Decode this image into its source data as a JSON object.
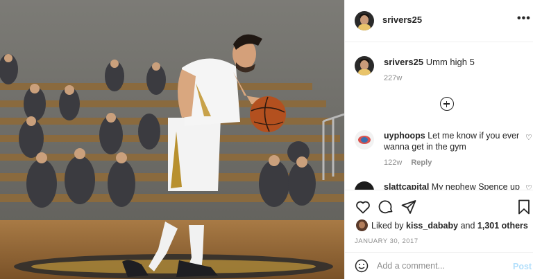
{
  "post": {
    "username": "srivers25",
    "more_icon": "more-horizontal-icon"
  },
  "caption": {
    "username": "srivers25",
    "text": "Umm high 5",
    "time": "227w"
  },
  "load_more_icon": "plus-circle-icon",
  "comments": [
    {
      "username": "uyphoops",
      "text": "Let me know if you ever wanna get in the gym",
      "time": "122w",
      "reply_label": "Reply"
    },
    {
      "username": "slattcapital",
      "text": "My nephew Spence up"
    }
  ],
  "actions": {
    "like_icon": "heart-icon",
    "comment_icon": "comment-icon",
    "share_icon": "share-icon",
    "save_icon": "bookmark-icon"
  },
  "likes": {
    "prefix": "Liked by",
    "user": "kiss_dababy",
    "and": "and",
    "count": "1,301 others"
  },
  "date": "JANUARY 30, 2017",
  "add_comment": {
    "placeholder": "Add a comment...",
    "post_label": "Post"
  },
  "colors": {
    "post_button_disabled": "#b2dffc",
    "muted_text": "#8e8e8e",
    "jersey_gold": "#e9c46a"
  }
}
